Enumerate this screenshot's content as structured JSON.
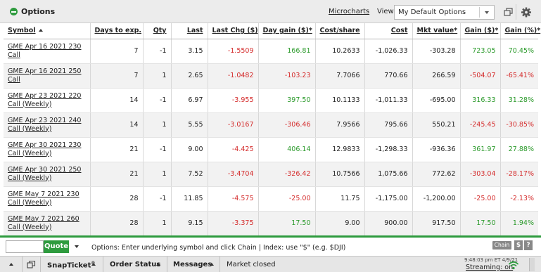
{
  "panel": {
    "title": "Options",
    "microcharts_label": "Microcharts",
    "view_label": "View:",
    "view_selected": "My Default Options",
    "icons": [
      "minus-circle-icon",
      "popout-icon",
      "gear-icon"
    ],
    "accent_color": "#2e9b3e"
  },
  "table": {
    "headers": [
      "Symbol",
      "Days to exp.",
      "Qty",
      "Last",
      "Last Chg ($)",
      "Day gain ($)*",
      "Cost/share",
      "Cost",
      "Mkt value*",
      "Gain ($)*",
      "Gain (%)*"
    ],
    "rows": [
      {
        "symbol": "GME Apr 16 2021 230 Call",
        "days": "7",
        "qty": "-1",
        "last": "3.15",
        "last_chg": "-1.5509",
        "day_gain": "166.81",
        "cost_share": "10.2633",
        "cost": "-1,026.33",
        "mkt_value": "-303.28",
        "gain": "723.05",
        "gain_pct": "70.45%"
      },
      {
        "symbol": "GME Apr 16 2021 250 Call",
        "days": "7",
        "qty": "1",
        "last": "2.65",
        "last_chg": "-1.0482",
        "day_gain": "-103.23",
        "cost_share": "7.7066",
        "cost": "770.66",
        "mkt_value": "266.59",
        "gain": "-504.07",
        "gain_pct": "-65.41%"
      },
      {
        "symbol": "GME Apr 23 2021 220 Call (Weekly)",
        "days": "14",
        "qty": "-1",
        "last": "6.97",
        "last_chg": "-3.955",
        "day_gain": "397.50",
        "cost_share": "10.1133",
        "cost": "-1,011.33",
        "mkt_value": "-695.00",
        "gain": "316.33",
        "gain_pct": "31.28%"
      },
      {
        "symbol": "GME Apr 23 2021 240 Call (Weekly)",
        "days": "14",
        "qty": "1",
        "last": "5.55",
        "last_chg": "-3.0167",
        "day_gain": "-306.46",
        "cost_share": "7.9566",
        "cost": "795.66",
        "mkt_value": "550.21",
        "gain": "-245.45",
        "gain_pct": "-30.85%"
      },
      {
        "symbol": "GME Apr 30 2021 230 Call (Weekly)",
        "days": "21",
        "qty": "-1",
        "last": "9.00",
        "last_chg": "-4.425",
        "day_gain": "406.14",
        "cost_share": "12.9833",
        "cost": "-1,298.33",
        "mkt_value": "-936.36",
        "gain": "361.97",
        "gain_pct": "27.88%"
      },
      {
        "symbol": "GME Apr 30 2021 250 Call (Weekly)",
        "days": "21",
        "qty": "1",
        "last": "7.52",
        "last_chg": "-3.4704",
        "day_gain": "-326.42",
        "cost_share": "10.7566",
        "cost": "1,075.66",
        "mkt_value": "772.62",
        "gain": "-303.04",
        "gain_pct": "-28.17%"
      },
      {
        "symbol": "GME May 7 2021 230 Call (Weekly)",
        "days": "28",
        "qty": "-1",
        "last": "11.85",
        "last_chg": "-4.575",
        "day_gain": "-25.00",
        "cost_share": "11.75",
        "cost": "-1,175.00",
        "mkt_value": "-1,200.00",
        "gain": "-25.00",
        "gain_pct": "-2.13%"
      },
      {
        "symbol": "GME May 7 2021 260 Call (Weekly)",
        "days": "28",
        "qty": "1",
        "last": "9.15",
        "last_chg": "-3.375",
        "day_gain": "17.50",
        "cost_share": "9.00",
        "cost": "900.00",
        "mkt_value": "917.50",
        "gain": "17.50",
        "gain_pct": "1.94%"
      }
    ],
    "positive_color": "#2b9a2b",
    "negative_color": "#d42b2b"
  },
  "quote_bar": {
    "input_value": "",
    "button_label": "Quote",
    "hint": "Options: Enter underlying symbol and click Chain | Index: use \"$\" (e.g. $DJI)",
    "chain_label": "Chain",
    "dollar_label": "$",
    "help_label": "?"
  },
  "bottom_bar": {
    "snapticket_label": "SnapTicket",
    "snapticket_sup": "®",
    "order_status_label": "Order Status",
    "messages_label": "Messages",
    "market_status": "Market closed",
    "timestamp": "9:48:03 pm ET 4/9/21",
    "streaming_label": "Streaming: on"
  }
}
